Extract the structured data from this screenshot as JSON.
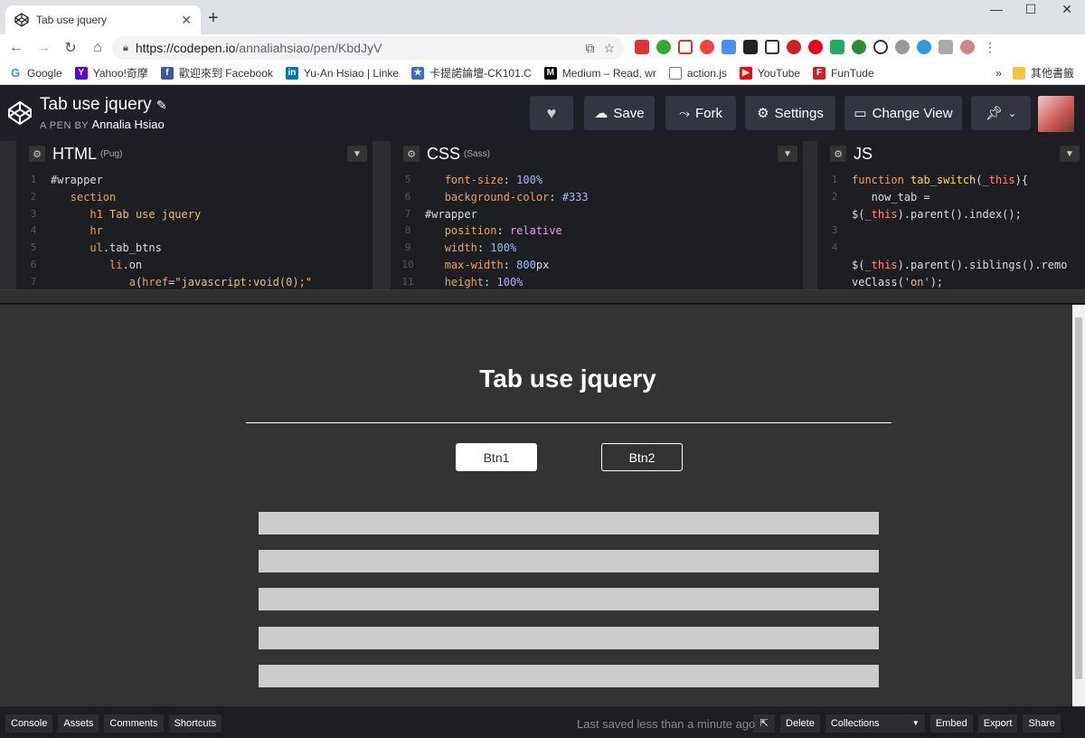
{
  "browser": {
    "tab_title": "Tab use jquery",
    "url_host": "https://codepen.io",
    "url_path": "/annaliahsiao/pen/KbdJyV",
    "bookmarks": [
      "Google",
      "Yahoo!奇摩",
      "歡迎來到 Facebook",
      "Yu-An Hsiao | Linke",
      "卡提諾論壇-CK101.C",
      "Medium – Read, wr",
      "action.js",
      "YouTube",
      "FunTude"
    ],
    "other_bookmarks": "其他書籤",
    "more": "»"
  },
  "codepen": {
    "title": "Tab use jquery",
    "pen_by": "A PEN BY",
    "author": "Annalia Hsiao",
    "buttons": {
      "save": "Save",
      "fork": "Fork",
      "settings": "Settings",
      "change_view": "Change View"
    }
  },
  "editors": {
    "html": {
      "title": "HTML",
      "sub": "(Pug)"
    },
    "css": {
      "title": "CSS",
      "sub": "(Sass)"
    },
    "js": {
      "title": "JS",
      "sub": ""
    }
  },
  "preview": {
    "title": "Tab use jquery",
    "btn1": "Btn1",
    "btn2": "Btn2"
  },
  "bottom": {
    "console": "Console",
    "assets": "Assets",
    "comments": "Comments",
    "shortcuts": "Shortcuts",
    "saved": "Last saved less than a minute ago",
    "delete": "Delete",
    "collections": "Collections",
    "embed": "Embed",
    "export": "Export",
    "share": "Share"
  }
}
